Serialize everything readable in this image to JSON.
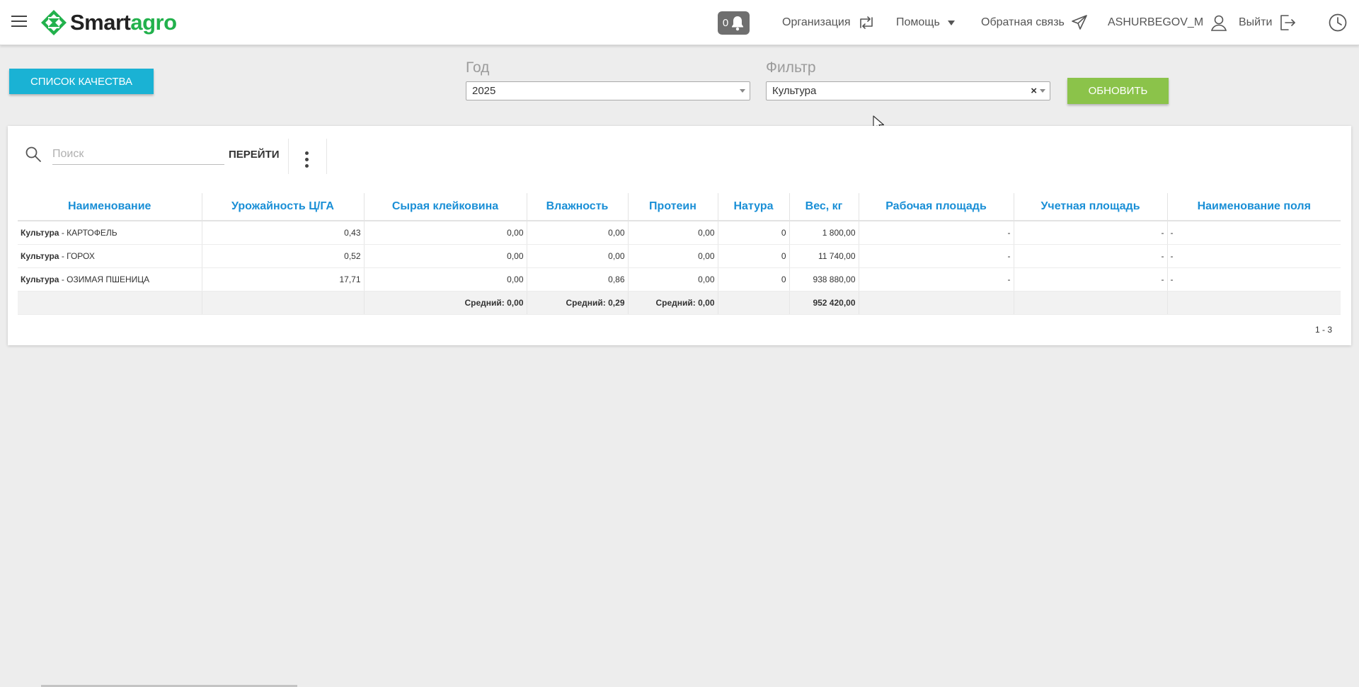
{
  "header": {
    "brand_smart": "Smart",
    "brand_agro": "agro",
    "notifications_count": "0",
    "nav": {
      "organization": "Организация",
      "help": "Помощь",
      "feedback": "Обратная связь",
      "user": "ASHURBEGOV_M",
      "logout": "Выйти"
    }
  },
  "controls": {
    "quality_list_button": "СПИСОК КАЧЕСТВА",
    "year_label": "Год",
    "year_value": "2025",
    "filter_label": "Фильтр",
    "filter_value": "Культура",
    "clear_symbol": "×",
    "refresh_button": "ОБНОВИТЬ"
  },
  "toolbar": {
    "search_placeholder": "Поиск",
    "goto_label": "ПЕРЕЙТИ"
  },
  "table": {
    "columns": [
      "Наименование",
      "Урожайность Ц/ГА",
      "Сырая клейковина",
      "Влажность",
      "Протеин",
      "Натура",
      "Вес, кг",
      "Рабочая площадь",
      "Учетная площадь",
      "Наименование поля"
    ],
    "rows": [
      {
        "prefix": "Культура",
        "name": " - КАРТОФЕЛЬ",
        "yield": "0,43",
        "gluten": "0,00",
        "moisture": "0,00",
        "protein": "0,00",
        "nature": "0",
        "weight": "1 800,00",
        "work_area": "-",
        "acct_area": "-",
        "field_name": "-"
      },
      {
        "prefix": "Культура",
        "name": " - ГОРОХ",
        "yield": "0,52",
        "gluten": "0,00",
        "moisture": "0,00",
        "protein": "0,00",
        "nature": "0",
        "weight": "11 740,00",
        "work_area": "-",
        "acct_area": "-",
        "field_name": "-"
      },
      {
        "prefix": "Культура",
        "name": " - ОЗИМАЯ ПШЕНИЦА",
        "yield": "17,71",
        "gluten": "0,00",
        "moisture": "0,86",
        "protein": "0,00",
        "nature": "0",
        "weight": "938 880,00",
        "work_area": "-",
        "acct_area": "-",
        "field_name": "-"
      }
    ],
    "totals": {
      "gluten": "Средний: 0,00",
      "moisture": "Средний: 0,29",
      "protein": "Средний: 0,00",
      "weight": "952 420,00"
    },
    "pager": "1 - 3"
  },
  "colors": {
    "accent_blue": "#1ab2d4",
    "accent_green": "#8bc34a",
    "brand_green": "#22b14c",
    "header_text_blue": "#1a8fd6"
  }
}
